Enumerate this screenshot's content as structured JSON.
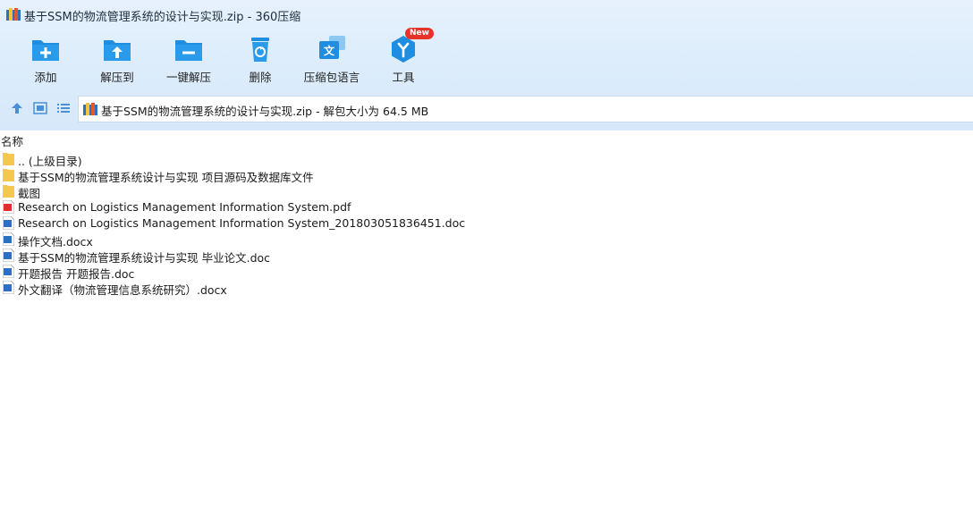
{
  "window": {
    "title": "基于SSM的物流管理系统的设计与实现.zip - 360压缩"
  },
  "toolbar": {
    "items": [
      {
        "label": "添加",
        "icon": "add-icon"
      },
      {
        "label": "解压到",
        "icon": "extract-to-icon"
      },
      {
        "label": "一键解压",
        "icon": "one-click-extract-icon"
      },
      {
        "label": "删除",
        "icon": "delete-icon"
      },
      {
        "label": "压缩包语言",
        "icon": "archive-language-icon"
      },
      {
        "label": "工具",
        "icon": "tools-icon"
      }
    ],
    "new_badge": "New"
  },
  "path": {
    "text": "基于SSM的物流管理系统的设计与实现.zip - 解包大小为 64.5 MB"
  },
  "list": {
    "column_name": "名称",
    "rows": [
      {
        "name": ".. (上级目录)",
        "type": "folder"
      },
      {
        "name": "基于SSM的物流管理系统设计与实现 项目源码及数据库文件",
        "type": "folder"
      },
      {
        "name": "截图",
        "type": "folder"
      },
      {
        "name": "Research on Logistics Management Information System.pdf",
        "type": "pdf"
      },
      {
        "name": "Research on Logistics Management Information System_201803051836451.doc",
        "type": "doc"
      },
      {
        "name": "操作文档.docx",
        "type": "doc"
      },
      {
        "name": "基于SSM的物流管理系统设计与实现 毕业论文.doc",
        "type": "doc"
      },
      {
        "name": "开题报告 开题报告.doc",
        "type": "doc"
      },
      {
        "name": "外文翻译（物流管理信息系统研究）.docx",
        "type": "doc"
      }
    ]
  },
  "colors": {
    "toolbar_blue": "#1f8ee0",
    "folder_yellow": "#f6c64e",
    "pdf_red": "#d9332b",
    "doc_blue": "#2f6fbf",
    "badge_red": "#e8332b"
  }
}
